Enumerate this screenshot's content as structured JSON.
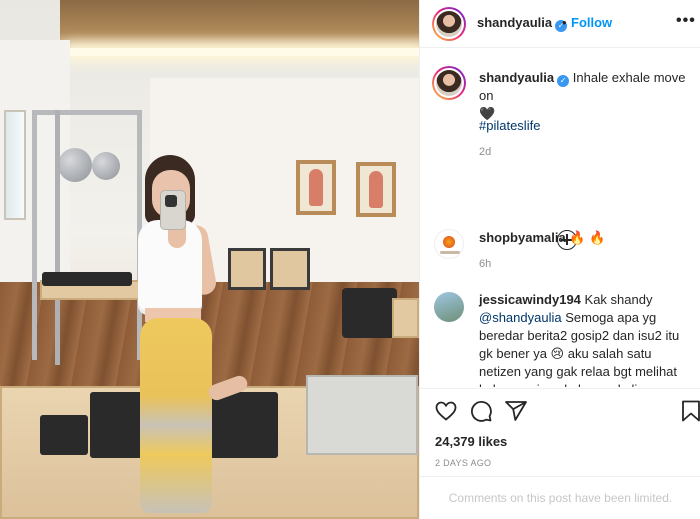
{
  "post": {
    "image_alt": "",
    "author": "shandyaulia",
    "follow_label": "Follow",
    "more_label": "•••",
    "dot": "•"
  },
  "caption": {
    "username": "shandyaulia",
    "text": "Inhale exhale move on",
    "emoji": "🖤",
    "hashtag": "#pilateslife",
    "time": "2d"
  },
  "comments": [
    {
      "username": "shopbyamalia",
      "text": "🔥 🔥",
      "time": "6h"
    },
    {
      "username": "jessicawindy194",
      "text_before": "Kak shandy",
      "mention": "@shandyaulia",
      "text_after": "Semoga apa yg beredar berita2 gosip2 dan isu2 itu gk bener ya 😢 aku salah satu netizen yang gak relaa bgt melihat keharmonisan keluarga kalian berakhir😢 setelah"
    }
  ],
  "stats": {
    "likes": "24,379 likes",
    "date": "2 DAYS AGO"
  },
  "footer": {
    "limited": "Comments on this post have been limited."
  },
  "icons": [
    "heart-icon",
    "comment-icon",
    "share-icon",
    "bookmark-icon",
    "plus-circle-icon",
    "verified-icon"
  ],
  "colors": {
    "link": "#0095f6",
    "verified": "#3897f0",
    "muted": "#8e8e8e",
    "hashtag": "#00376b"
  }
}
